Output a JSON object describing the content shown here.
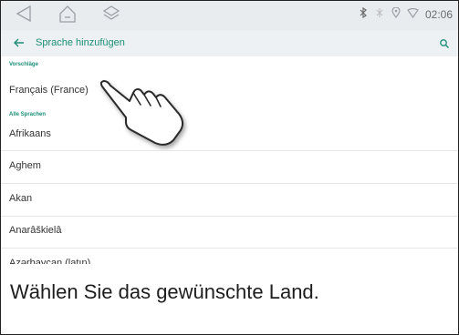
{
  "status": {
    "time": "02:06"
  },
  "appbar": {
    "title": "Sprache hinzufügen"
  },
  "sections": {
    "suggestions": "Vorschläge",
    "all": "Alle Sprachen"
  },
  "languages": {
    "suggested": "Français (France)",
    "items": [
      "Afrikaans",
      "Aghem",
      "Akan",
      "Anarâškielâ",
      "Azərbaycan (latın)"
    ]
  },
  "caption": "Wählen Sie das gewünschte Land.",
  "colors": {
    "accent": "#1a8e77",
    "statusbar": "#e9ecef",
    "appbar": "#eef1f3"
  },
  "icons": [
    "back-triangle-icon",
    "home-icon",
    "layers-icon",
    "bluetooth-icon",
    "signal-icon",
    "location-icon",
    "wifi-icon",
    "back-arrow-icon",
    "search-icon",
    "pointing-hand-icon"
  ]
}
